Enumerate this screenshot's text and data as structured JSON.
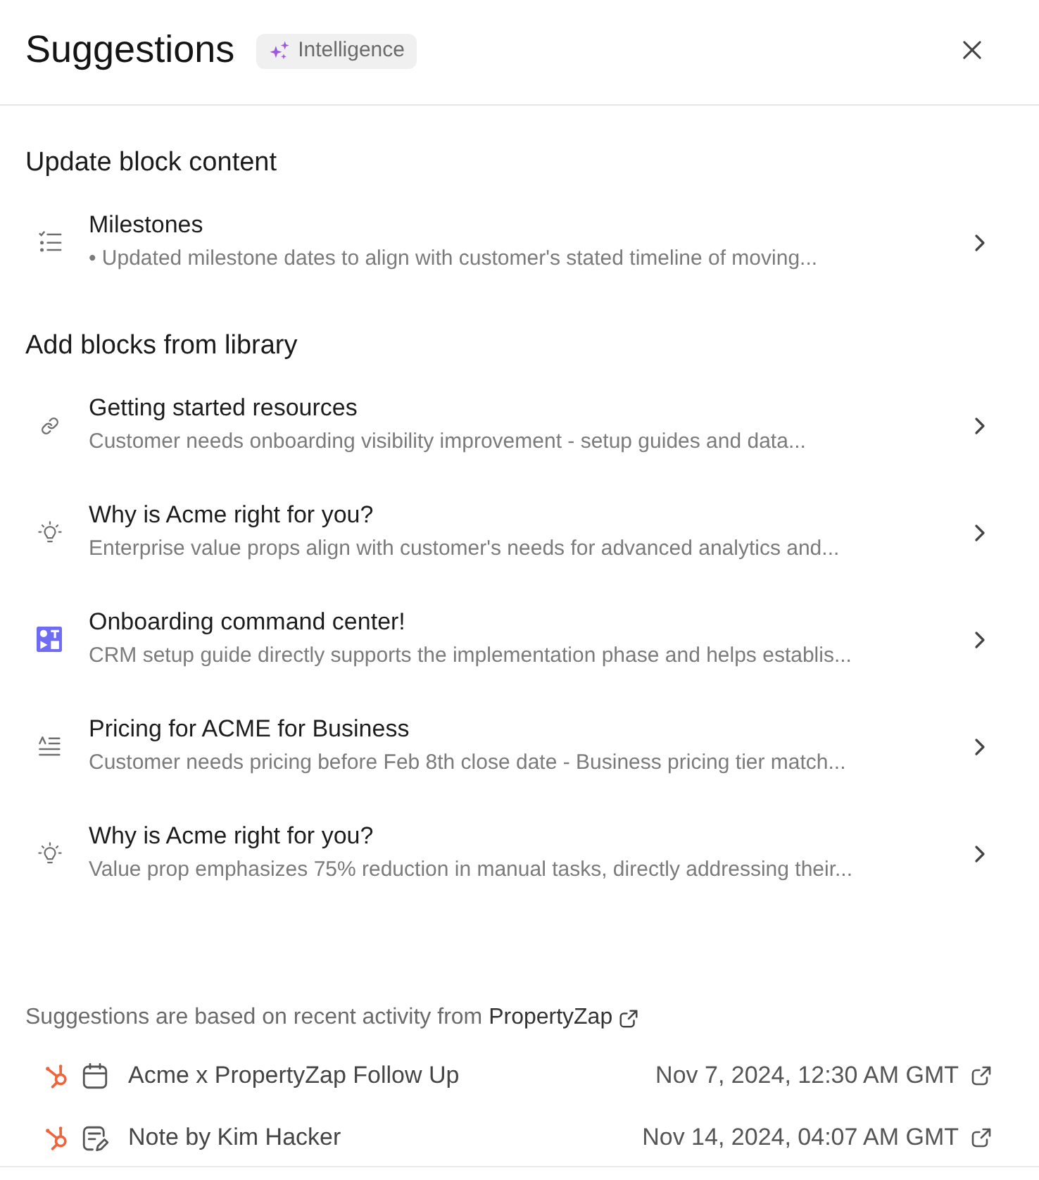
{
  "header": {
    "title": "Suggestions",
    "badge": "Intelligence"
  },
  "sections": [
    {
      "heading": "Update block content",
      "items": [
        {
          "kind": "checklist",
          "title": "Milestones",
          "description": "• Updated milestone dates to align with customer's stated timeline of moving..."
        }
      ]
    },
    {
      "heading": "Add blocks from library",
      "items": [
        {
          "kind": "link",
          "title": "Getting started resources",
          "description": "Customer needs onboarding visibility improvement - setup guides and data..."
        },
        {
          "kind": "idea",
          "title": "Why is Acme right for you?",
          "description": "Enterprise value props align with customer's needs for advanced analytics and..."
        },
        {
          "kind": "board",
          "title": "Onboarding command center!",
          "description": "CRM setup guide directly supports the implementation phase and helps establis..."
        },
        {
          "kind": "text",
          "title": "Pricing for ACME for Business",
          "description": "Customer needs pricing before Feb 8th close date - Business pricing tier match..."
        },
        {
          "kind": "idea",
          "title": "Why is Acme right for you?",
          "description": "Value prop emphasizes 75% reduction in manual tasks, directly addressing their..."
        }
      ]
    }
  ],
  "footer": {
    "note": "Suggestions are based on recent activity from",
    "source": "PropertyZap",
    "activities": [
      {
        "kind": "meeting",
        "title": "Acme x PropertyZap Follow Up",
        "date": "Nov 7, 2024, 12:30 AM GMT"
      },
      {
        "kind": "note",
        "title": "Note by Kim Hacker",
        "date": "Nov 14, 2024, 04:07 AM GMT"
      }
    ]
  }
}
